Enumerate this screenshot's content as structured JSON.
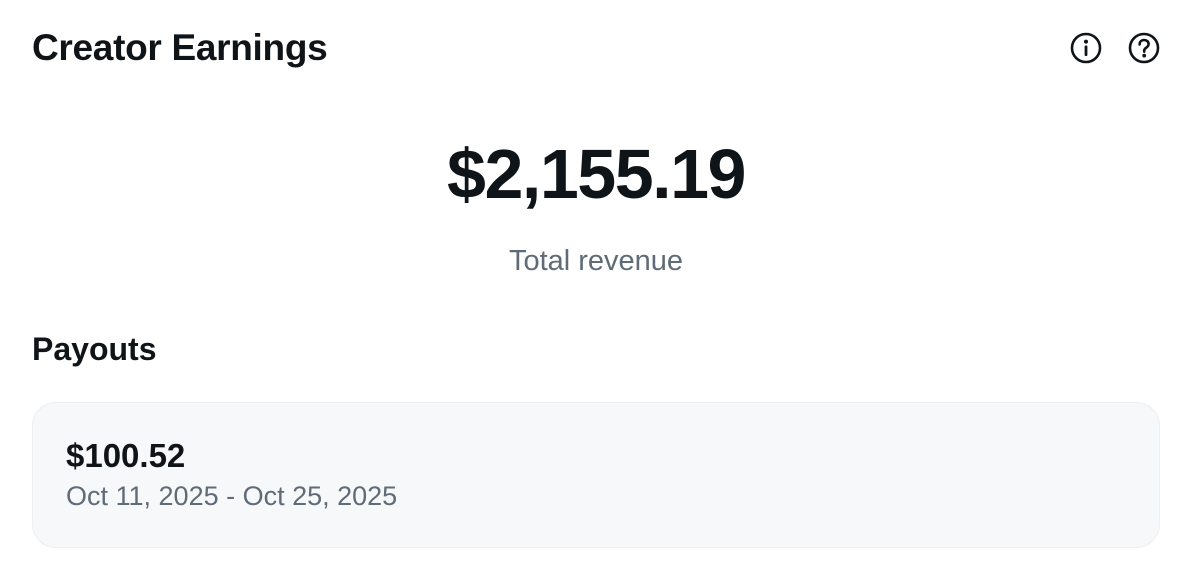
{
  "header": {
    "title": "Creator Earnings",
    "icons": [
      "info-icon",
      "help-icon"
    ]
  },
  "summary": {
    "total_amount": "$2,155.19",
    "total_label": "Total revenue"
  },
  "payouts": {
    "heading": "Payouts",
    "items": [
      {
        "amount": "$100.52",
        "period": "Oct 11, 2025 - Oct 25, 2025"
      }
    ]
  },
  "colors": {
    "text_primary": "#0f1419",
    "text_secondary": "#5f6b76",
    "card_background": "#f7f8fa"
  }
}
